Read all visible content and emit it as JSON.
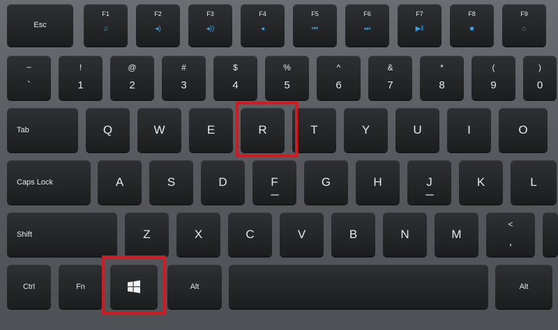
{
  "row_fn": [
    {
      "label": "Esc",
      "icon": ""
    },
    {
      "label": "F1",
      "icon": "♫"
    },
    {
      "label": "F2",
      "icon": "◂)"
    },
    {
      "label": "F3",
      "icon": "◂))"
    },
    {
      "label": "F4",
      "icon": "◂"
    },
    {
      "label": "F5",
      "icon": "⏮"
    },
    {
      "label": "F6",
      "icon": "⏭"
    },
    {
      "label": "F7",
      "icon": "▶‖"
    },
    {
      "label": "F8",
      "icon": "■"
    },
    {
      "label": "F9",
      "icon": "⌂"
    }
  ],
  "row_num": [
    {
      "top": "~",
      "bot": "`"
    },
    {
      "top": "!",
      "bot": "1"
    },
    {
      "top": "@",
      "bot": "2"
    },
    {
      "top": "#",
      "bot": "3"
    },
    {
      "top": "$",
      "bot": "4"
    },
    {
      "top": "%",
      "bot": "5"
    },
    {
      "top": "^",
      "bot": "6"
    },
    {
      "top": "&",
      "bot": "7"
    },
    {
      "top": "*",
      "bot": "8"
    },
    {
      "top": "(",
      "bot": "9"
    },
    {
      "top": ")",
      "bot": "0"
    }
  ],
  "row_q": [
    "Tab",
    "Q",
    "W",
    "E",
    "R",
    "T",
    "Y",
    "U",
    "I",
    "O"
  ],
  "row_a": [
    "Caps Lock",
    "A",
    "S",
    "D",
    "F",
    "G",
    "H",
    "J",
    "K",
    "L"
  ],
  "row_z": [
    "Shift",
    "Z",
    "X",
    "C",
    "V",
    "B",
    "N",
    "M",
    "<",
    ","
  ],
  "row_bottom": [
    "Ctrl",
    "Fn",
    "",
    "Alt",
    "",
    "Alt"
  ],
  "highlight_color": "#d7191f",
  "icons": {
    "windows_key": "windows-logo-icon"
  }
}
